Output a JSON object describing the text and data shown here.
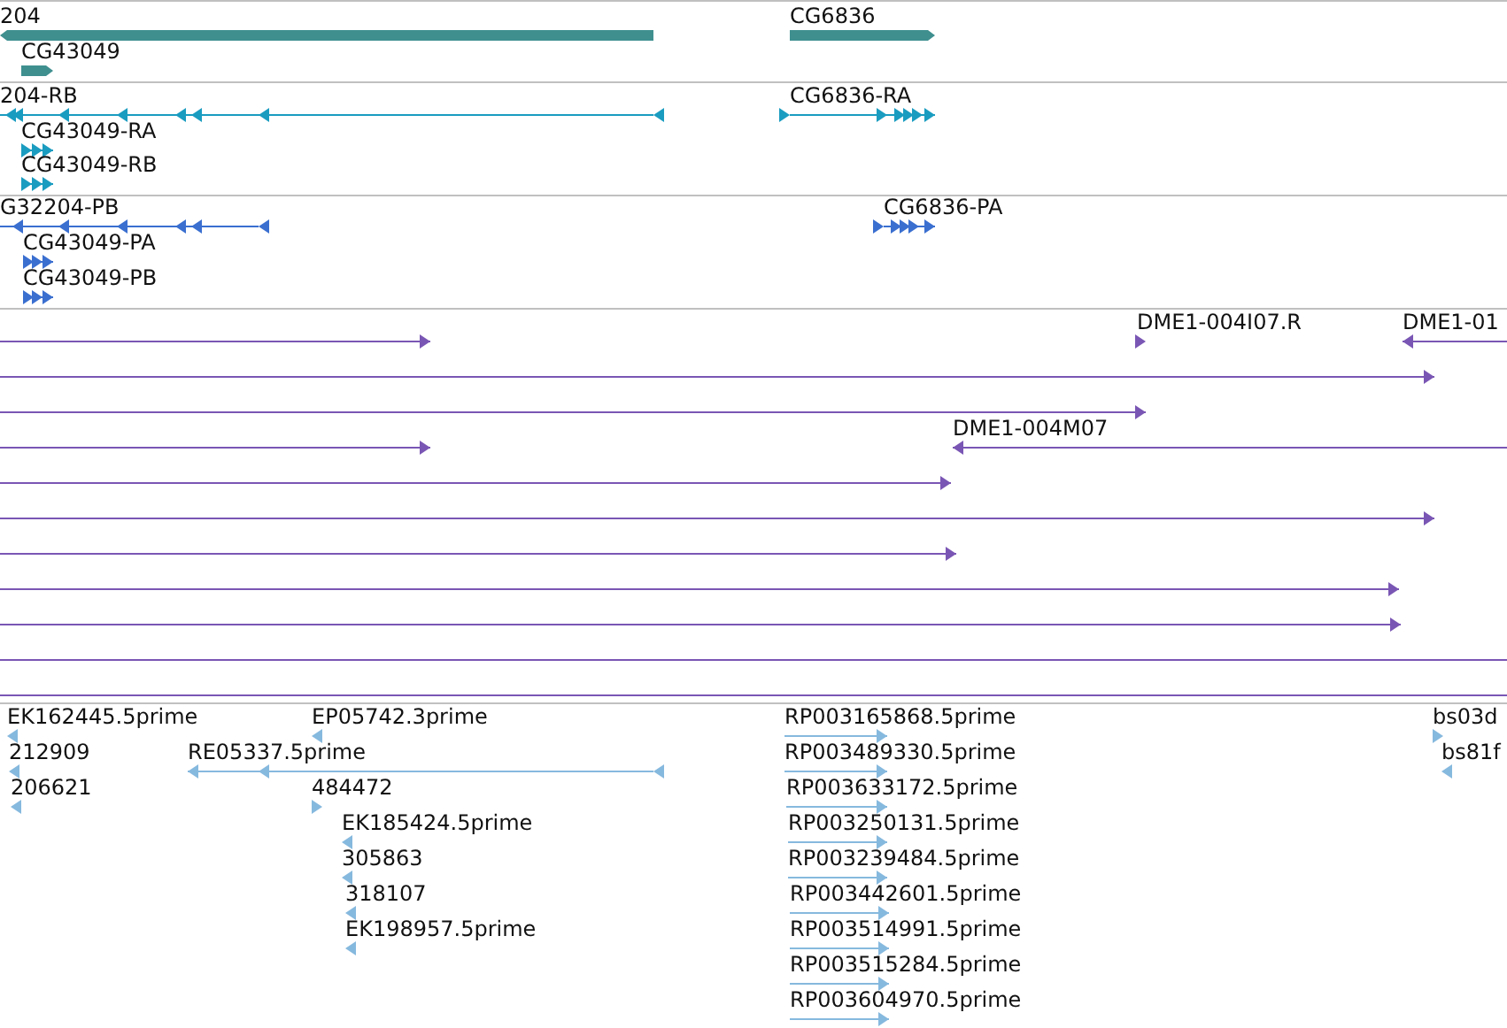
{
  "tracks": [
    {
      "kind": "gene",
      "features": [
        {
          "label": "204",
          "reverse": true
        },
        {
          "label": "CG6836",
          "reverse": false
        },
        {
          "label": "CG43049",
          "reverse": false
        }
      ]
    },
    {
      "kind": "transcript",
      "features": [
        {
          "label": "204-RB",
          "reverse": true
        },
        {
          "label": "CG6836-RA",
          "reverse": false
        },
        {
          "label": "CG43049-RA",
          "reverse": false
        },
        {
          "label": "CG43049-RB",
          "reverse": false
        }
      ]
    },
    {
      "kind": "protein",
      "features": [
        {
          "label": "G32204-PB",
          "reverse": true
        },
        {
          "label": "CG6836-PA",
          "reverse": false
        },
        {
          "label": "CG43049-PA",
          "reverse": false
        },
        {
          "label": "CG43049-PB",
          "reverse": false
        }
      ]
    },
    {
      "kind": "clone",
      "features": [
        {
          "label": "DME1-004I07.R",
          "reverse": false
        },
        {
          "label": "DME1-01",
          "reverse": true
        },
        {
          "reverse": false
        },
        {
          "reverse": false
        },
        {
          "reverse": false
        },
        {
          "reverse": false
        },
        {
          "label": "DME1-004M07",
          "reverse": true
        },
        {
          "reverse": false
        },
        {
          "reverse": false
        },
        {
          "reverse": false
        },
        {
          "reverse": false
        },
        {
          "reverse": false
        },
        {
          "reverse": false
        },
        {
          "reverse": false
        }
      ]
    },
    {
      "kind": "est",
      "features": [
        {
          "label": "EK162445.5prime",
          "reverse": true
        },
        {
          "label": "212909",
          "reverse": true
        },
        {
          "label": "206621",
          "reverse": true
        },
        {
          "label": "EP05742.3prime",
          "reverse": true
        },
        {
          "label": "RE05337.5prime",
          "reverse": true
        },
        {
          "label": "484472",
          "reverse": false
        },
        {
          "label": "EK185424.5prime",
          "reverse": true
        },
        {
          "label": "305863",
          "reverse": true
        },
        {
          "label": "318107",
          "reverse": true
        },
        {
          "label": "EK198957.5prime",
          "reverse": true
        },
        {
          "label": "RP003165868.5prime",
          "reverse": false
        },
        {
          "label": "RP003489330.5prime",
          "reverse": false
        },
        {
          "label": "RP003633172.5prime",
          "reverse": false
        },
        {
          "label": "RP003250131.5prime",
          "reverse": false
        },
        {
          "label": "RP003239484.5prime",
          "reverse": false
        },
        {
          "label": "RP003442601.5prime",
          "reverse": false
        },
        {
          "label": "RP003514991.5prime",
          "reverse": false
        },
        {
          "label": "RP003515284.5prime",
          "reverse": false
        },
        {
          "label": "RP003604970.5prime",
          "reverse": false
        },
        {
          "label": "bs03d",
          "reverse": false
        },
        {
          "label": "bs81f",
          "reverse": true
        }
      ]
    }
  ]
}
